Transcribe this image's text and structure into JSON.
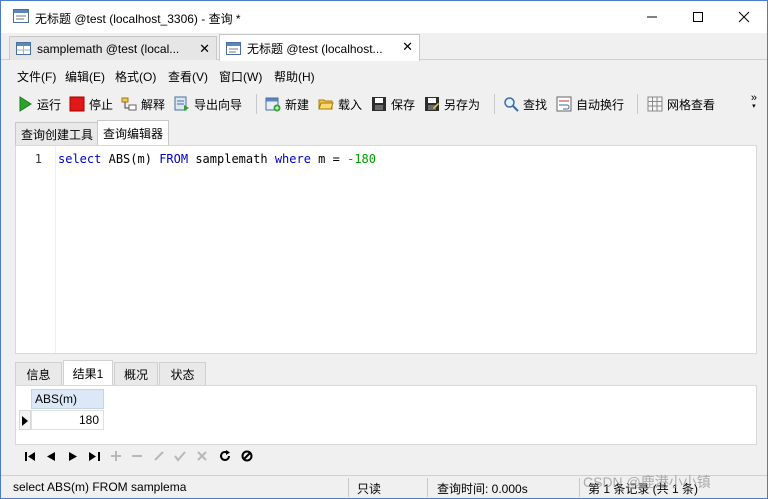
{
  "window": {
    "title": "无标题 @test (localhost_3306) - 查询 *"
  },
  "doc_tabs": [
    {
      "label": "samplemath @test (local...",
      "close": "✕"
    },
    {
      "label": "无标题 @test (localhost...",
      "close": "✕"
    }
  ],
  "menu": [
    "文件(F)",
    "编辑(E)",
    "格式(O)",
    "查看(V)",
    "窗口(W)",
    "帮助(H)"
  ],
  "toolbar": {
    "run": "运行",
    "stop": "停止",
    "explain": "解释",
    "export_wizard": "导出向导",
    "new": "新建",
    "load": "载入",
    "save": "保存",
    "save_as": "另存为",
    "find": "查找",
    "word_wrap": "自动换行",
    "grid_view": "网格查看",
    "more": "»"
  },
  "sub_tabs": [
    "查询创建工具",
    "查询编辑器"
  ],
  "editor": {
    "line_number": "1",
    "sql_kw_select": "select",
    "sql_func": "ABS(m)",
    "sql_kw_from": "FROM",
    "sql_table": "samplemath",
    "sql_kw_where": "where",
    "sql_cond": "m =",
    "sql_value": "-180"
  },
  "result_tabs": [
    "信息",
    "结果1",
    "概况",
    "状态"
  ],
  "grid": {
    "column": "ABS(m)",
    "rows": [
      [
        "180"
      ]
    ]
  },
  "status": {
    "sql": "select ABS(m) FROM samplema",
    "mode": "只读",
    "query_time": "查询时间: 0.000s",
    "record": "第 1 条记录 (共 1 条)"
  },
  "watermark": "CSDN @鹿港小小镇",
  "colors": {
    "keyword": "#0000c0",
    "number": "#00a000",
    "grid_header": "#dce8f7",
    "window_border": "#4a7cc7"
  }
}
